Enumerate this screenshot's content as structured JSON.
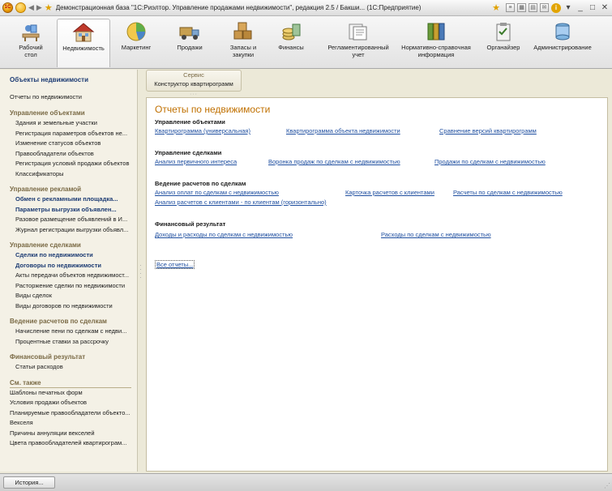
{
  "window": {
    "title": "Демонстрационная база \"1С:Риэлтор. Управление продажами недвижимости\", редакция 2.5 / Бакши... (1С:Предприятие)",
    "logo_text": "1С"
  },
  "sections": [
    {
      "label": "Рабочий\nстол",
      "icon": "desk-icon"
    },
    {
      "label": "Недвижимость",
      "icon": "house-icon",
      "active": true
    },
    {
      "label": "Маркетинг",
      "icon": "pie-chart-icon"
    },
    {
      "label": "Продажи",
      "icon": "truck-icon"
    },
    {
      "label": "Запасы и\nзакупки",
      "icon": "boxes-icon"
    },
    {
      "label": "Финансы",
      "icon": "coins-icon"
    },
    {
      "label": "Регламентированный\nучет",
      "icon": "documents-icon"
    },
    {
      "label": "Нормативно-справочная\nинформация",
      "icon": "binders-icon"
    },
    {
      "label": "Органайзер",
      "icon": "clipboard-icon"
    },
    {
      "label": "Администрирование",
      "icon": "server-icon"
    }
  ],
  "sidebar": {
    "header": "Объекты недвижимости",
    "top_link": "Отчеты по недвижимости",
    "groups": [
      {
        "title": "Управление объектами",
        "items": [
          {
            "label": "Здания и земельные участки"
          },
          {
            "label": "Регистрация параметров объектов не..."
          },
          {
            "label": "Изменение статусов объектов"
          },
          {
            "label": "Правообладатели объектов"
          },
          {
            "label": "Регистрация условий продажи объектов"
          },
          {
            "label": "Классификаторы"
          }
        ]
      },
      {
        "title": "Управление рекламой",
        "items": [
          {
            "label": "Обмен с рекламными площадка...",
            "bold": true
          },
          {
            "label": "Параметры выгрузки объявлен...",
            "bold": true
          },
          {
            "label": "Разовое размещение объявлений в И..."
          },
          {
            "label": "Журнал регистрации выгрузки объявл..."
          }
        ]
      },
      {
        "title": "Управление сделками",
        "items": [
          {
            "label": "Сделки по недвижимости",
            "bold": true
          },
          {
            "label": "Договоры по недвижимости",
            "bold": true
          },
          {
            "label": "Акты передачи объектов недвижимост..."
          },
          {
            "label": "Расторжение сделки по недвижимости"
          },
          {
            "label": "Виды сделок"
          },
          {
            "label": "Виды договоров по недвижимости"
          }
        ]
      },
      {
        "title": "Ведение расчетов по сделкам",
        "items": [
          {
            "label": "Начисление пени по сделкам с недви..."
          },
          {
            "label": "Процентные ставки за рассрочку"
          }
        ]
      },
      {
        "title": "Финансовый результат",
        "items": [
          {
            "label": "Статьи расходов"
          }
        ]
      }
    ],
    "see_also_title": "См. также",
    "see_also": [
      "Шаблоны печатных форм",
      "Условия продажи объектов",
      "Планируемые правообладатели объекто...",
      "Векселя",
      "Причины аннуляции векселей",
      "Цвета правообладателей квартирограм..."
    ]
  },
  "service": {
    "title": "Сервис",
    "button": "Конструктор квартирограмм"
  },
  "main": {
    "title": "Отчеты по недвижимости",
    "groups": [
      {
        "title": "Управление объектами",
        "rows": [
          [
            "Квартирограмма (универсальная)",
            "Квартирограмма объекта недвижимости",
            "Сравнение версий квартирограмм"
          ]
        ]
      },
      {
        "title": "Управление сделками",
        "rows": [
          [
            "Анализ первичного интереса",
            "Воронка продаж по сделкам с недвижимостью",
            "Продажи по сделкам с недвижимостью"
          ]
        ]
      },
      {
        "title": "Ведение расчетов по сделкам",
        "rows": [
          [
            "Анализ оплат по сделкам с недвижимостью",
            "Карточка расчетов с клиентами",
            "Расчеты по сделкам с недвижимостью"
          ],
          [
            "Анализ расчетов с клиентами - по клиентам (горизонтально)"
          ]
        ]
      },
      {
        "title": "Финансовый результат",
        "rows": [
          [
            "Доходы и расходы по сделкам с недвижимостью",
            "Расходы по сделкам с недвижимостью"
          ]
        ]
      }
    ],
    "all_reports": "Все отчеты..."
  },
  "bottom": {
    "history_button": "История..."
  }
}
